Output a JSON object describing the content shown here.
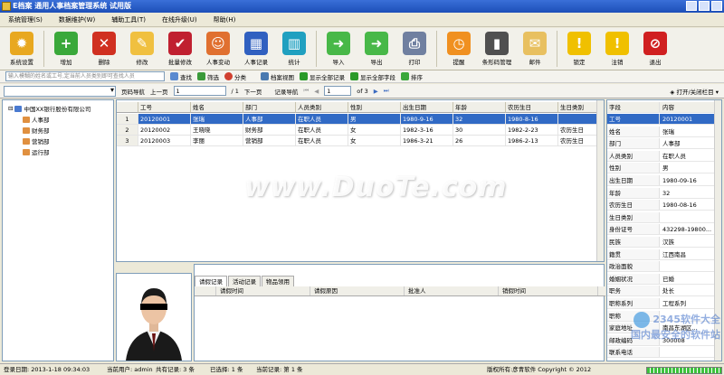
{
  "window": {
    "title": "E档案  通用人事档案管理系统  试用版"
  },
  "menu": [
    "系统管理(S)",
    "数据维护(W)",
    "辅助工具(T)",
    "在线升级(U)",
    "帮助(H)"
  ],
  "toolbar": [
    {
      "label": "系统设置",
      "icon": "gear-icon",
      "color": "#e8a820"
    },
    {
      "label": "增加",
      "icon": "plus-icon",
      "color": "#3aa83a"
    },
    {
      "label": "删除",
      "icon": "x-icon",
      "color": "#d03020"
    },
    {
      "label": "修改",
      "icon": "pencil-icon",
      "color": "#f0c040"
    },
    {
      "label": "批量修改",
      "icon": "checklist-icon",
      "color": "#c02030"
    },
    {
      "label": "人事变动",
      "icon": "users-icon",
      "color": "#e07030"
    },
    {
      "label": "人事记录",
      "icon": "grid-icon",
      "color": "#3060c0"
    },
    {
      "label": "统计",
      "icon": "chart-icon",
      "color": "#20a0c0"
    },
    {
      "label": "导入",
      "icon": "import-icon",
      "color": "#48b848"
    },
    {
      "label": "导出",
      "icon": "export-icon",
      "color": "#48b848"
    },
    {
      "label": "打印",
      "icon": "printer-icon",
      "color": "#7080a0"
    },
    {
      "label": "提醒",
      "icon": "clock-icon",
      "color": "#f09020"
    },
    {
      "label": "条形码管理",
      "icon": "barcode-icon",
      "color": "#505050"
    },
    {
      "label": "邮件",
      "icon": "mail-icon",
      "color": "#e8c060"
    },
    {
      "label": "锁定",
      "icon": "warning-icon",
      "color": "#f0c000"
    },
    {
      "label": "注销",
      "icon": "warning-icon",
      "color": "#f0c000"
    },
    {
      "label": "退出",
      "icon": "stop-icon",
      "color": "#d02020"
    }
  ],
  "search": {
    "placeholder": "输入模糊的姓名或工号,定当前人员类别即可查找人员",
    "find": "查找",
    "filter": "筛选",
    "classify": "分类",
    "archive_view": "档案视图",
    "show_all_records": "显示全部记录",
    "show_all_fields": "显示全部字段",
    "sort": "排序"
  },
  "nav": {
    "page_label": "页码导航",
    "prev_page": "上一页",
    "page_value": "1",
    "page_total": "/ 1",
    "next_page": "下一页",
    "record_label": "记录导航",
    "record_value": "1",
    "record_total": "of 3",
    "toggle_panel": "打开/关闭栏目"
  },
  "tree": {
    "root": "中国XX银行股份有限公司",
    "children": [
      "人事部",
      "财务部",
      "营销部",
      "运行部"
    ]
  },
  "grid": {
    "columns": [
      "工号",
      "姓名",
      "部门",
      "人员类别",
      "性别",
      "出生日期",
      "年龄",
      "农历生日",
      "生日类别"
    ],
    "rows": [
      {
        "idx": "1",
        "cells": [
          "20120001",
          "张瑞",
          "人事部",
          "在职人员",
          "男",
          "1980-9-16",
          "32",
          "1980-8-16",
          ""
        ]
      },
      {
        "idx": "2",
        "cells": [
          "20120002",
          "王晓晓",
          "财务部",
          "在职人员",
          "女",
          "1982-3-16",
          "30",
          "1982-2-23",
          "农历生日"
        ]
      },
      {
        "idx": "3",
        "cells": [
          "20120003",
          "李丽",
          "营销部",
          "在职人员",
          "女",
          "1986-3-21",
          "26",
          "1986-2-13",
          "农历生日"
        ]
      }
    ]
  },
  "bottom_tabs": {
    "tabs": [
      "请假记录",
      "活动记录",
      "物品领用"
    ],
    "columns": [
      "请假时间",
      "请假原因",
      "批准人",
      "销假时间"
    ]
  },
  "details": {
    "header": {
      "field": "字段",
      "content": "内容"
    },
    "rows": [
      {
        "field": "工号",
        "value": "20120001"
      },
      {
        "field": "姓名",
        "value": "张瑞"
      },
      {
        "field": "部门",
        "value": "人事部"
      },
      {
        "field": "人员类别",
        "value": "在职人员"
      },
      {
        "field": "性别",
        "value": "男"
      },
      {
        "field": "出生日期",
        "value": "1980-09-16"
      },
      {
        "field": "年龄",
        "value": "32"
      },
      {
        "field": "农历生日",
        "value": "1980-08-16"
      },
      {
        "field": "生日类别",
        "value": ""
      },
      {
        "field": "身份证号",
        "value": "432298-19800..."
      },
      {
        "field": "民族",
        "value": "汉族"
      },
      {
        "field": "籍贯",
        "value": "江西南昌"
      },
      {
        "field": "政治面貌",
        "value": ""
      },
      {
        "field": "婚姻状况",
        "value": "已婚"
      },
      {
        "field": "职务",
        "value": "处长"
      },
      {
        "field": "职称系列",
        "value": "工程系列"
      },
      {
        "field": "职称",
        "value": ""
      },
      {
        "field": "家庭地址",
        "value": "南昌东湖区..."
      },
      {
        "field": "邮政编码",
        "value": "300008"
      },
      {
        "field": "联系电话",
        "value": ""
      }
    ]
  },
  "status": {
    "date": "登录日期:  2013-1-18 09:34:03",
    "user": "当前用户:  admin",
    "total": "共有记录:  3 条",
    "selected": "已选择:  1 条",
    "current": "当前记录:  第 1 条",
    "copyright": "版权所有:彦青软件 Copyright © 2012"
  },
  "watermarks": {
    "main": "www.DuoTe.com",
    "site": "2345软件大全",
    "slogan": "国内最安全的软件站"
  }
}
